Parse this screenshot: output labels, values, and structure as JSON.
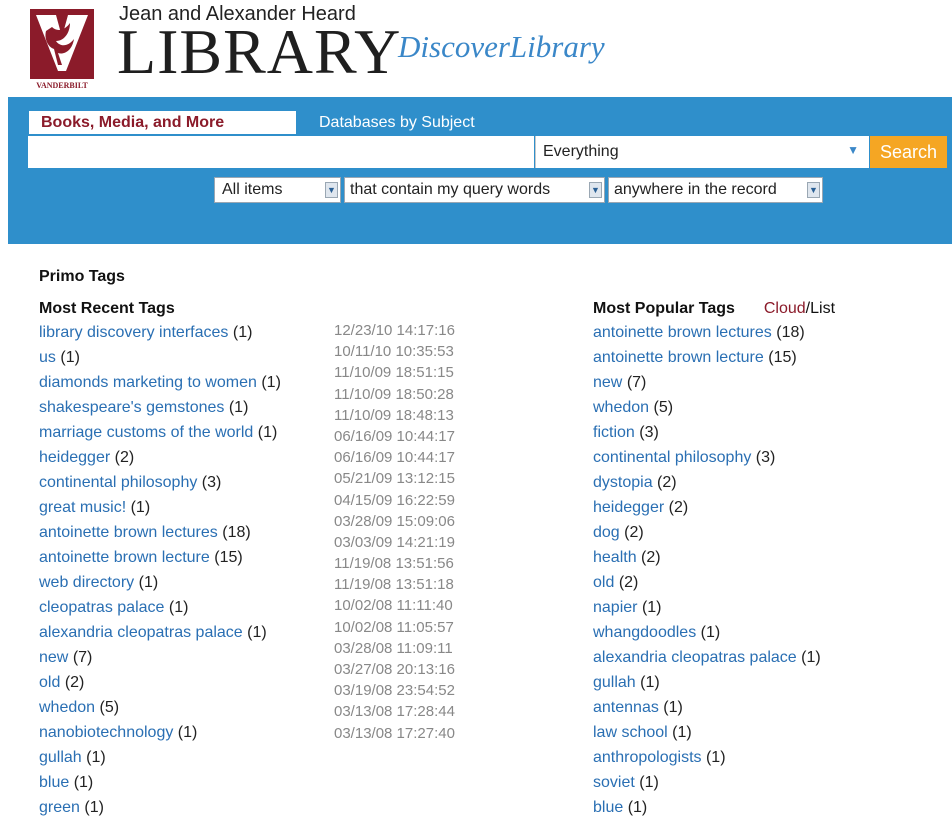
{
  "header": {
    "badge_text": "VANDERBILT",
    "subtitle": "Jean and Alexander Heard",
    "library_word": "LIBRARY",
    "discover": "DiscoverLibrary"
  },
  "search": {
    "tabs": [
      {
        "label": "Books, Media, and More",
        "active": true
      },
      {
        "label": "Databases by Subject",
        "active": false
      }
    ],
    "query_value": "",
    "scope_value": "Everything",
    "button_label": "Search",
    "filters": [
      {
        "value": "All items"
      },
      {
        "value": "that contain my query words"
      },
      {
        "value": "anywhere in the record"
      }
    ]
  },
  "tags": {
    "page_title": "Primo Tags",
    "recent_title": "Most Recent Tags",
    "popular_title": "Most Popular Tags",
    "view_cloud": "Cloud",
    "view_sep": "/",
    "view_list": "List",
    "recent": [
      {
        "name": "library discovery interfaces",
        "count": "(1)"
      },
      {
        "name": "us",
        "count": "(1)"
      },
      {
        "name": "diamonds marketing to women",
        "count": "(1)"
      },
      {
        "name": "shakespeare's gemstones",
        "count": "(1)"
      },
      {
        "name": "marriage customs of the world",
        "count": "(1)"
      },
      {
        "name": "heidegger",
        "count": "(2)"
      },
      {
        "name": "continental philosophy",
        "count": "(3)"
      },
      {
        "name": "great music!",
        "count": "(1)"
      },
      {
        "name": "antoinette brown lectures",
        "count": "(18)"
      },
      {
        "name": "antoinette brown lecture",
        "count": "(15)"
      },
      {
        "name": "web directory",
        "count": "(1)"
      },
      {
        "name": "cleopatras palace",
        "count": "(1)"
      },
      {
        "name": "alexandria cleopatras palace",
        "count": "(1)"
      },
      {
        "name": "new",
        "count": "(7)"
      },
      {
        "name": "old",
        "count": "(2)"
      },
      {
        "name": "whedon",
        "count": "(5)"
      },
      {
        "name": "nanobiotechnology",
        "count": "(1)"
      },
      {
        "name": "gullah",
        "count": "(1)"
      },
      {
        "name": "blue",
        "count": "(1)"
      },
      {
        "name": "green",
        "count": "(1)"
      }
    ],
    "dates": [
      "12/23/10 14:17:16",
      "10/11/10 10:35:53",
      "11/10/09 18:51:15",
      "11/10/09 18:50:28",
      "11/10/09 18:48:13",
      "06/16/09 10:44:17",
      "06/16/09 10:44:17",
      "05/21/09 13:12:15",
      "04/15/09 16:22:59",
      "03/28/09 15:09:06",
      "03/03/09 14:21:19",
      "11/19/08 13:51:56",
      "11/19/08 13:51:18",
      "10/02/08 11:11:40",
      "10/02/08 11:05:57",
      "03/28/08 11:09:11",
      "03/27/08 20:13:16",
      "03/19/08 23:54:52",
      "03/13/08 17:28:44",
      "03/13/08 17:27:40"
    ],
    "popular": [
      {
        "name": "antoinette brown lectures",
        "count": "(18)"
      },
      {
        "name": "antoinette brown lecture",
        "count": "(15)"
      },
      {
        "name": "new",
        "count": "(7)"
      },
      {
        "name": "whedon",
        "count": "(5)"
      },
      {
        "name": "fiction",
        "count": "(3)"
      },
      {
        "name": "continental philosophy",
        "count": "(3)"
      },
      {
        "name": "dystopia",
        "count": "(2)"
      },
      {
        "name": "heidegger",
        "count": "(2)"
      },
      {
        "name": "dog",
        "count": "(2)"
      },
      {
        "name": "health",
        "count": "(2)"
      },
      {
        "name": "old",
        "count": "(2)"
      },
      {
        "name": "napier",
        "count": "(1)"
      },
      {
        "name": "whangdoodles",
        "count": "(1)"
      },
      {
        "name": "alexandria cleopatras palace",
        "count": "(1)"
      },
      {
        "name": "gullah",
        "count": "(1)"
      },
      {
        "name": "antennas",
        "count": "(1)"
      },
      {
        "name": "law school",
        "count": "(1)"
      },
      {
        "name": "anthropologists",
        "count": "(1)"
      },
      {
        "name": "soviet",
        "count": "(1)"
      },
      {
        "name": "blue",
        "count": "(1)"
      }
    ]
  },
  "colors": {
    "panel": "#2f8fcb",
    "tab_active_text": "#8b1b2a",
    "link": "#2a6fb3",
    "search_button": "#f5a623",
    "date_text": "#888888"
  },
  "icons": {
    "badge": "vanderbilt-oak-leaf-icon",
    "dropdown": "chevron-down-icon"
  }
}
